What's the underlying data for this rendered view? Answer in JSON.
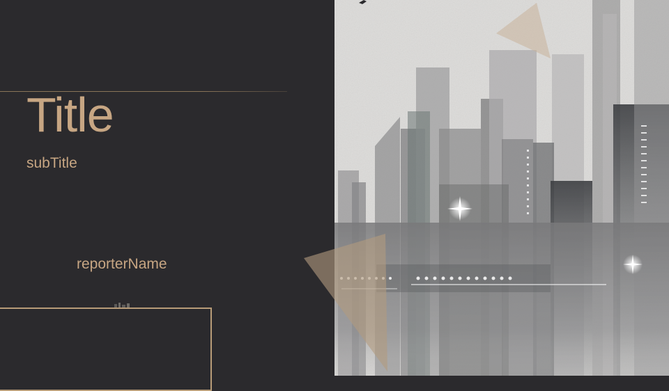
{
  "slide": {
    "title": "Title",
    "subtitle": "subTitle",
    "reporter": "reporterName"
  },
  "colors": {
    "background": "#2b2a2d",
    "accent": "#c7a683",
    "frame": "#b89c78",
    "triangle": "#b39b7e"
  },
  "image": {
    "subject": "city-skyline-illustration"
  }
}
